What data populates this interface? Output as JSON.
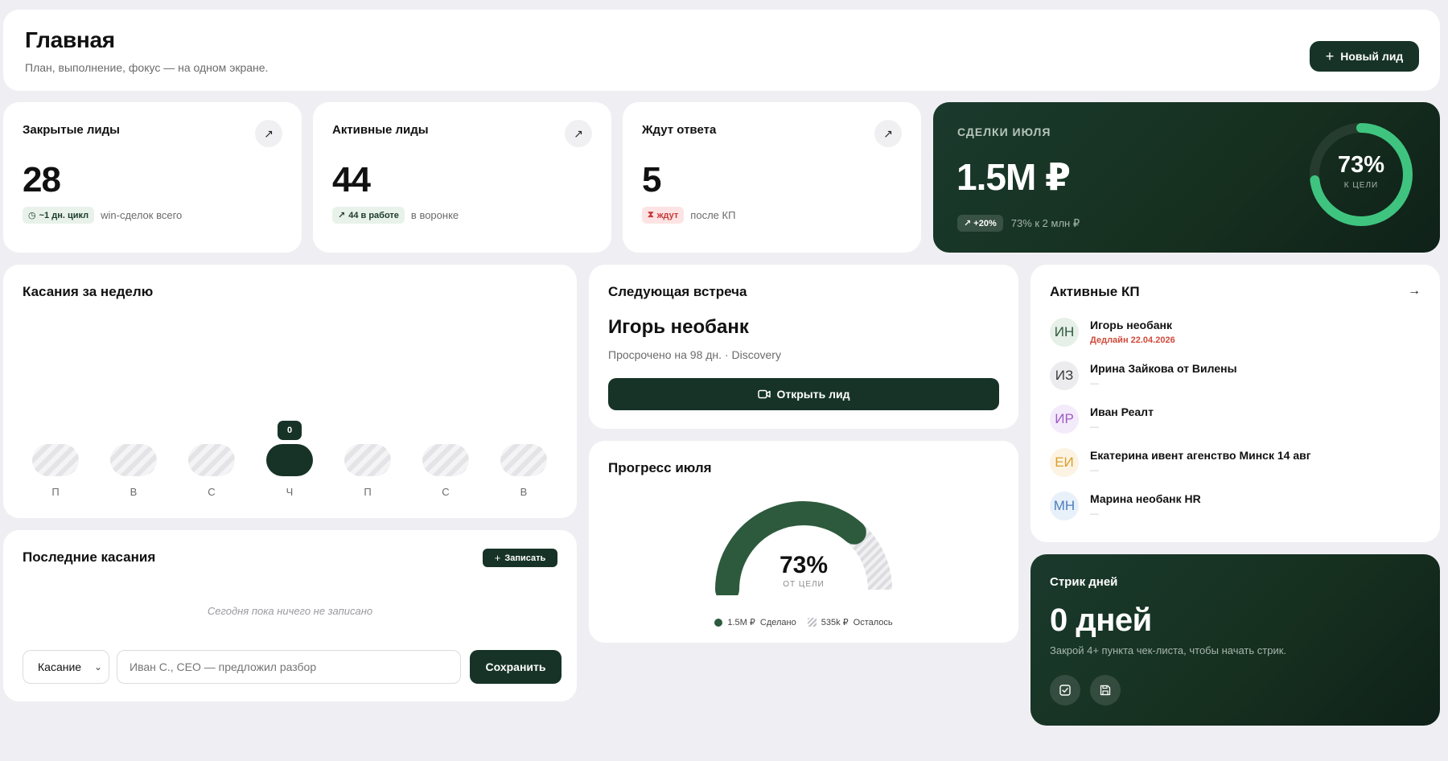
{
  "header": {
    "title": "Главная",
    "subtitle": "План, выполнение, фокус — на одном экране.",
    "new_lead_label": "Новый лид"
  },
  "kpis": [
    {
      "label": "Закрытые лиды",
      "value": "28",
      "badge": "~1 дн. цикл",
      "note": "win-сделок всего"
    },
    {
      "label": "Активные лиды",
      "value": "44",
      "badge": "44 в работе",
      "note": "в воронке"
    },
    {
      "label": "Ждут ответа",
      "value": "5",
      "badge": "ждут",
      "note": "после КП"
    }
  ],
  "deals": {
    "label": "СДЕЛКИ ИЮЛЯ",
    "value": "1.5M ₽",
    "badge": "+20%",
    "note": "73% к 2 млн ₽",
    "ring_pct": "73%",
    "ring_label": "К ЦЕЛИ",
    "ring_fraction": 0.73
  },
  "week": {
    "title": "Касания за неделю",
    "days": [
      "П",
      "В",
      "С",
      "Ч",
      "П",
      "С",
      "В"
    ],
    "active_index": 3,
    "active_value": "0"
  },
  "meeting": {
    "title": "Следующая встреча",
    "name": "Игорь необанк",
    "meta": "Просрочено на 98 дн. · Discovery",
    "open_label": "Открыть лид"
  },
  "kp": {
    "title": "Активные КП",
    "items": [
      {
        "initials": "ИН",
        "name": "Игорь необанк",
        "sub": "Дедлайн 22.04.2026",
        "color": "#2d5a3d",
        "bg": "#e6efe8"
      },
      {
        "initials": "ИЗ",
        "name": "Ирина Зайкова от Вилены",
        "sub": "—",
        "color": "#3a3a3a",
        "bg": "#ececee"
      },
      {
        "initials": "ИР",
        "name": "Иван Реалт",
        "sub": "—",
        "color": "#9c5cc7",
        "bg": "#f3eafa"
      },
      {
        "initials": "ЕИ",
        "name": "Екатерина ивент агенство Минск 14 авг",
        "sub": "—",
        "color": "#d8a030",
        "bg": "#fcf3e2"
      },
      {
        "initials": "МН",
        "name": "Марина необанк HR",
        "sub": "—",
        "color": "#4a7ec0",
        "bg": "#e8f0fa"
      }
    ]
  },
  "recent": {
    "title": "Последние касания",
    "add_label": "Записать",
    "empty": "Сегодня пока ничего не записано",
    "select_value": "Касание",
    "input_placeholder": "Иван С., CEO — предложил разбор",
    "save_label": "Сохранить"
  },
  "progress": {
    "title": "Прогресс июля",
    "pct": "73%",
    "pct_label": "ОТ ЦЕЛИ",
    "fraction": 0.73,
    "done_value": "1.5M ₽",
    "done_label": "Сделано",
    "left_value": "535k ₽",
    "left_label": "Осталось"
  },
  "streak": {
    "title": "Стрик дней",
    "value": "0 дней",
    "note": "Закрой 4+ пункта чек-листа, чтобы начать стрик."
  },
  "colors": {
    "accent": "#173327",
    "ring": "#3fc47f",
    "progress": "#2d5a3d"
  }
}
